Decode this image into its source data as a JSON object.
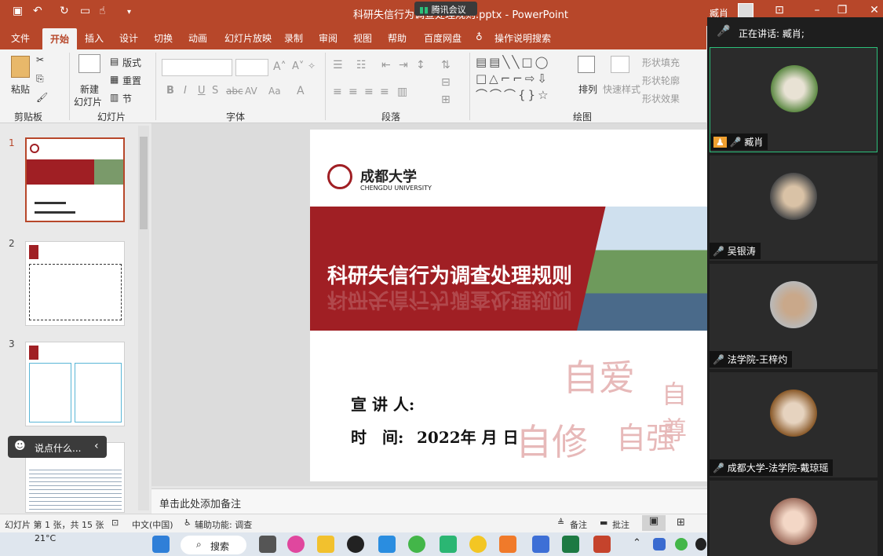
{
  "window": {
    "title": "科研失信行为调查处理规则.pptx - PowerPoint",
    "meeting_app": "腾讯会议",
    "user": "臧肖"
  },
  "ribbon_tabs": [
    "文件",
    "开始",
    "插入",
    "设计",
    "切换",
    "动画",
    "幻灯片放映",
    "录制",
    "审阅",
    "视图",
    "帮助",
    "百度网盘",
    "操作说明搜索"
  ],
  "active_tab": "开始",
  "ribbon": {
    "clipboard": {
      "paste": "粘贴",
      "group": "剪贴板"
    },
    "slides": {
      "new_slide_1": "新建",
      "new_slide_2": "幻灯片",
      "layout": "版式",
      "reset": "重置",
      "section": "节",
      "group": "幻灯片"
    },
    "font": {
      "group": "字体"
    },
    "paragraph": {
      "group": "段落"
    },
    "drawing": {
      "arrange": "排列",
      "quick_styles": "快速样式",
      "shape_fill": "形状填充",
      "shape_outline": "形状轮廓",
      "shape_effects": "形状效果",
      "group": "绘图"
    }
  },
  "thumbnails": [
    "1",
    "2",
    "3",
    "4"
  ],
  "chat_pill": "说点什么...",
  "slide": {
    "university_cn": "成都大学",
    "university_en": "CHENGDU UNIVERSITY",
    "title": "科研失信行为调查处理规则",
    "speaker_label": "宣 讲 人:",
    "time_label": "时　间:",
    "time_value": "2022年 月 日",
    "calligraphy": [
      "自爱",
      "自尊",
      "自修",
      "自强"
    ]
  },
  "notes_placeholder": "单击此处添加备注",
  "status": {
    "slide_info": "幻灯片 第 1 张，共 15 张",
    "language": "中文(中国)",
    "accessibility": "辅助功能: 调查",
    "notes": "备注",
    "comments": "批注"
  },
  "taskbar": {
    "weather": "21°C",
    "search": "搜索"
  },
  "meeting": {
    "speaking": "正在讲话: 臧肖;",
    "participants": [
      "臧肖",
      "吴银涛",
      "法学院-王梓灼",
      "成都大学-法学院-戴琼瑶",
      ""
    ]
  },
  "colors": {
    "accent": "#b7472a",
    "slide_red": "#a01f24",
    "meeting_bg": "#1e1e1e",
    "active_border": "#2bbf7a"
  }
}
